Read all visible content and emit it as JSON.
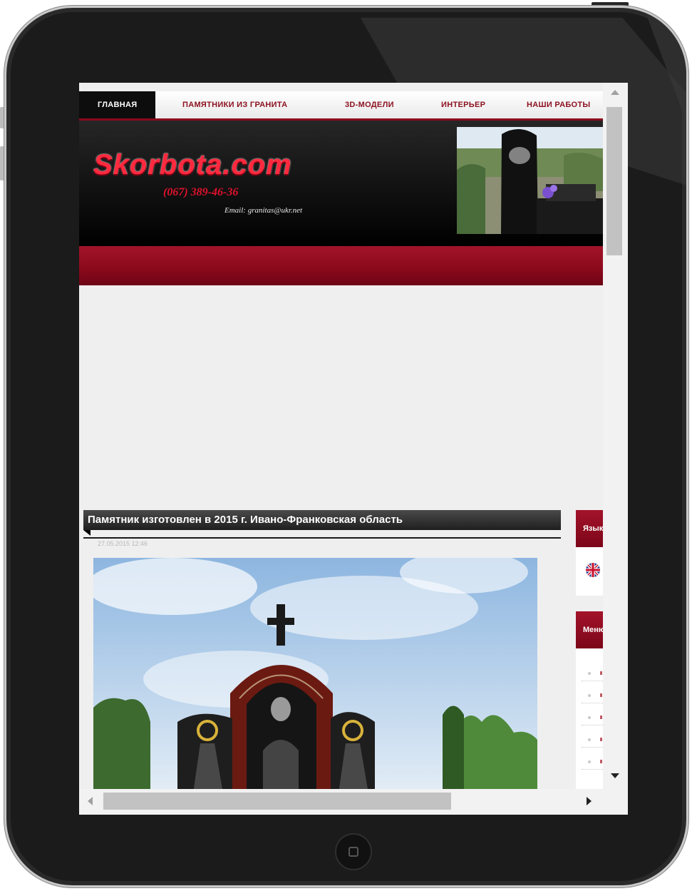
{
  "nav": {
    "items": [
      {
        "label": "ГЛАВНАЯ",
        "active": true
      },
      {
        "label": "ПАМЯТНИКИ ИЗ ГРАНИТА",
        "active": false
      },
      {
        "label": "3D-МОДЕЛИ",
        "active": false
      },
      {
        "label": "ИНТЕРЬЕР",
        "active": false
      },
      {
        "label": "НАШИ РАБОТЫ",
        "active": false
      }
    ]
  },
  "header": {
    "logo": "Skorbota.com",
    "phone": "(067) 389-46-36",
    "email": "Email: granitas@ukr.net"
  },
  "article": {
    "title": "Памятник изготовлен в 2015 г. Ивано-Франковская область",
    "date": "27.05.2015 12:46"
  },
  "sidebar": {
    "language_header": "Язык",
    "menu_header": "Меню"
  },
  "colors": {
    "accent_red": "#8c0a1c",
    "logo_red": "#ff2a3f",
    "device_black": "#1b1b1b"
  },
  "icons": {
    "flag": "uk-flag-icon",
    "home": "home-button-icon"
  }
}
